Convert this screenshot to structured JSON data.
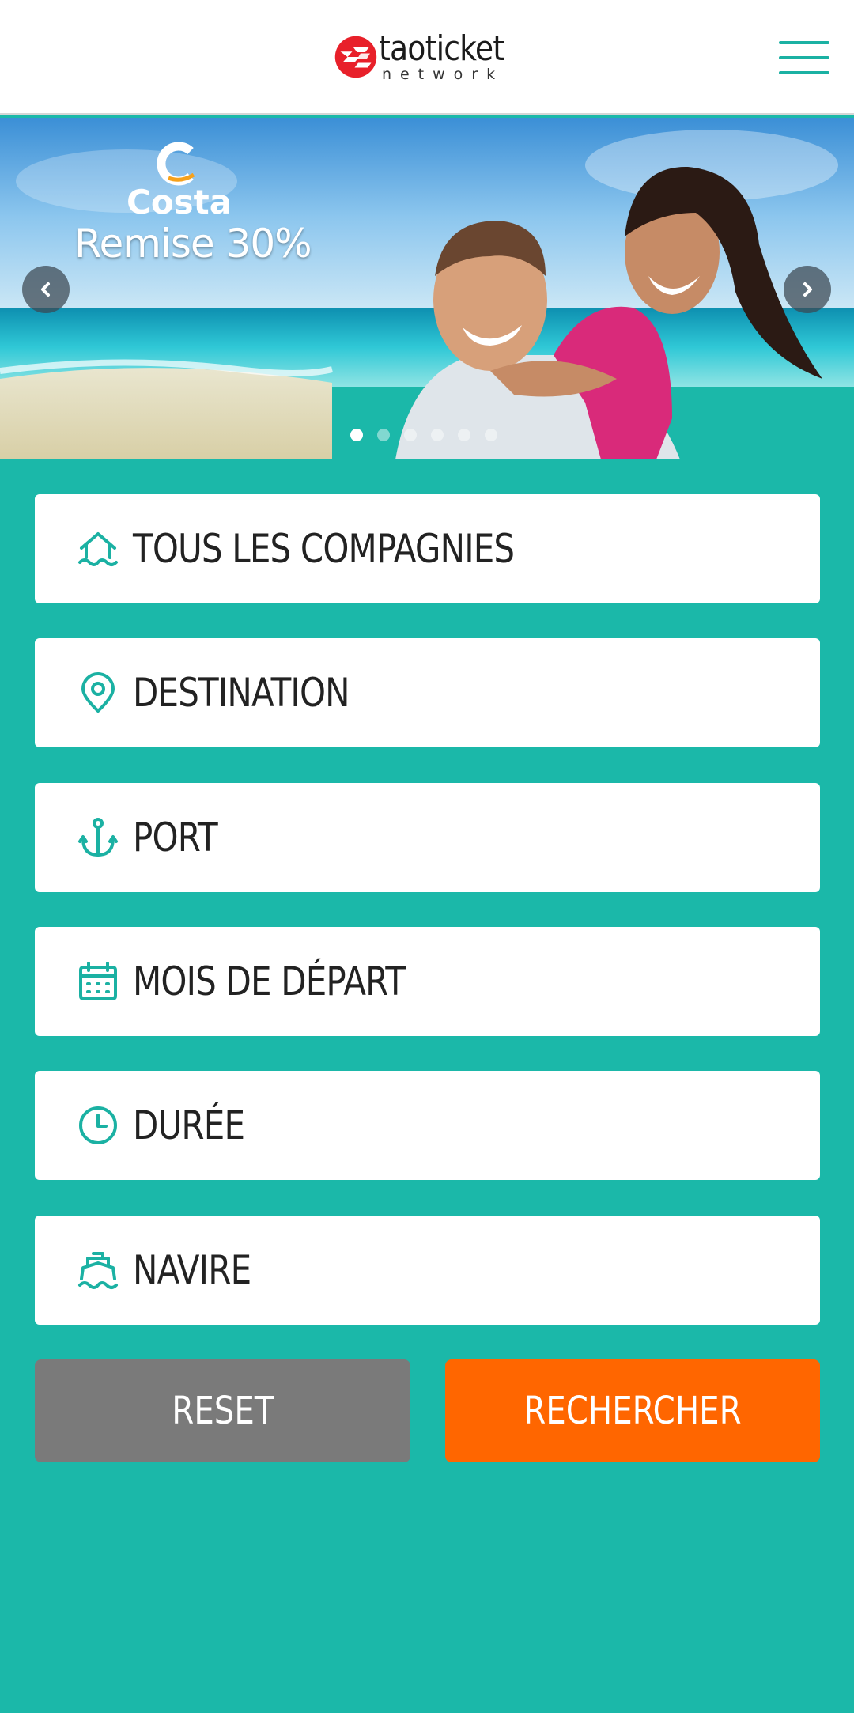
{
  "header": {
    "logo_name": "taoticket",
    "logo_sub": "network"
  },
  "hero": {
    "brand": "Costa",
    "promo": "Remise 30%",
    "slides_count": 6,
    "active_slide": 1
  },
  "form": {
    "fields": [
      {
        "label": "TOUS LES COMPAGNIES",
        "icon": "company-house-wave-icon"
      },
      {
        "label": "DESTINATION",
        "icon": "map-pin-icon"
      },
      {
        "label": "PORT",
        "icon": "anchor-icon"
      },
      {
        "label": "MOIS DE DÉPART",
        "icon": "calendar-icon"
      },
      {
        "label": "DURÉE",
        "icon": "clock-icon"
      },
      {
        "label": "NAVIRE",
        "icon": "ship-icon"
      }
    ],
    "reset_label": "RESET",
    "search_label": "RECHERCHER"
  },
  "colors": {
    "background": "#1bb8a9",
    "accent": "#1bb1a3",
    "reset": "#7a7a7a",
    "search": "#ff6600",
    "logo_red": "#e8202a"
  }
}
